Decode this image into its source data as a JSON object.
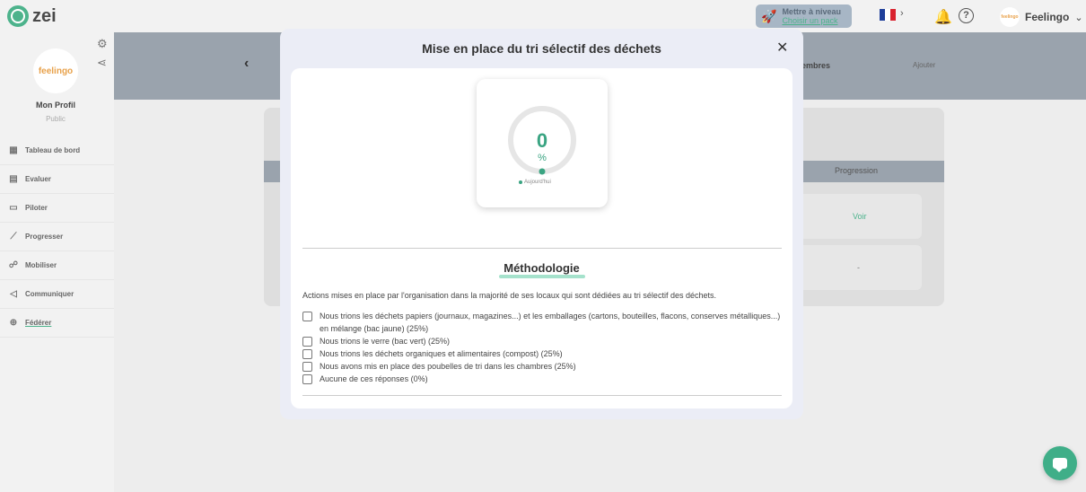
{
  "app": {
    "logo_text": "zei"
  },
  "topbar": {
    "levelup_title": "Mettre à niveau",
    "levelup_sub": "Choisir un pack",
    "flag_chevron": "›",
    "user_avatar": "feelingo",
    "user_name": "Feelingo",
    "user_chevron": "⌄"
  },
  "sidebar": {
    "profile_logo": "feelingo",
    "profile_name": "Mon Profil",
    "profile_visibility": "Public",
    "items": [
      {
        "label": "Tableau de bord",
        "icon": "grid-icon"
      },
      {
        "label": "Evaluer",
        "icon": "document-icon"
      },
      {
        "label": "Piloter",
        "icon": "monitor-icon"
      },
      {
        "label": "Progresser",
        "icon": "chart-icon"
      },
      {
        "label": "Mobiliser",
        "icon": "people-icon"
      },
      {
        "label": "Communiquer",
        "icon": "megaphone-icon"
      },
      {
        "label": "Fédérer",
        "icon": "plus-circle-icon"
      }
    ]
  },
  "background": {
    "membres": "membres",
    "ajouter": "Ajouter",
    "progression_header": "Progression",
    "voir": "Voir",
    "row2_value": "-"
  },
  "modal": {
    "title": "Mise en place du tri sélectif des déchets",
    "close_icon": "close-icon",
    "gauge": {
      "value": "0",
      "unit": "%",
      "legend": "Aujourd'hui",
      "percent": 0,
      "color": "#3aa482"
    },
    "methodology_title": "Méthodologie",
    "methodology_desc": "Actions mises en place par l'organisation dans la majorité de ses locaux qui sont dédiées au tri sélectif des déchets.",
    "options": [
      {
        "label": "Nous trions les déchets papiers (journaux, magazines...) et les emballages (cartons, bouteilles, flacons, conserves métalliques...) en mélange (bac jaune) (25%)",
        "checked": false
      },
      {
        "label": "Nous trions le verre (bac vert) (25%)",
        "checked": false
      },
      {
        "label": "Nous trions les déchets organiques et alimentaires (compost) (25%)",
        "checked": false
      },
      {
        "label": "Nous avons mis en place des poubelles de tri dans les chambres (25%)",
        "checked": false
      },
      {
        "label": "Aucune de ces réponses (0%)",
        "checked": false
      }
    ]
  },
  "colors": {
    "accent": "#4db38c",
    "gauge_track": "#e6e6e6"
  }
}
